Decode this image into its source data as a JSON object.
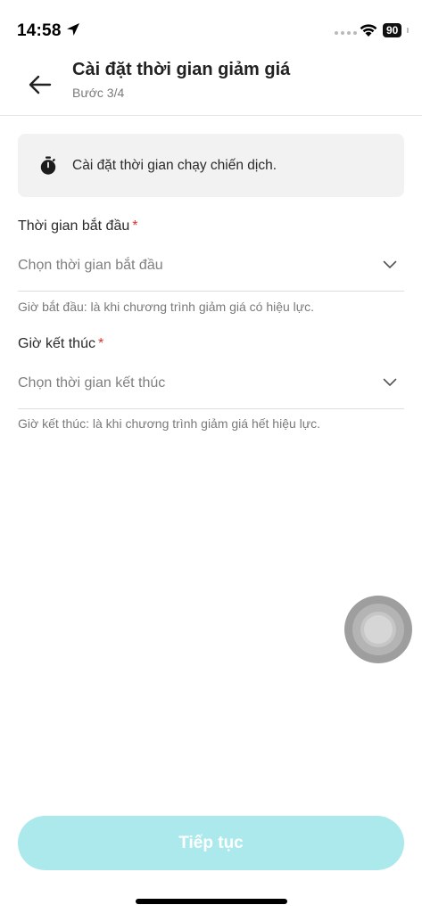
{
  "status_bar": {
    "time": "14:58",
    "battery": "90"
  },
  "header": {
    "title": "Cài đặt thời gian giảm giá",
    "step": "Bước 3/4"
  },
  "info": {
    "text": "Cài đặt thời gian chạy chiến dịch."
  },
  "start_field": {
    "label": "Thời gian bắt đầu",
    "required_mark": "*",
    "placeholder": "Chọn thời gian bắt đầu",
    "helper": "Giờ bắt đầu: là khi chương trình giảm giá có hiệu lực."
  },
  "end_field": {
    "label": "Giờ kết thúc",
    "required_mark": "*",
    "placeholder": "Chọn thời gian kết thúc",
    "helper": "Giờ kết thúc: là khi chương trình giảm giá hết hiệu lực."
  },
  "footer": {
    "continue_label": "Tiếp tục"
  },
  "colors": {
    "accent_disabled": "#ace9ec",
    "required": "#e03131"
  }
}
